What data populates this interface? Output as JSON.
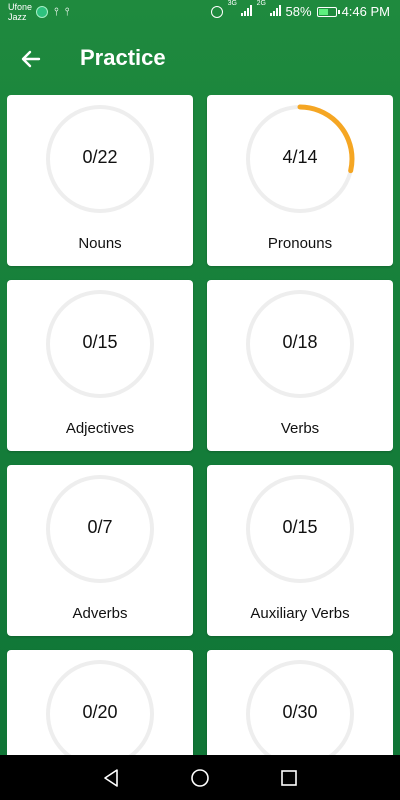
{
  "status_bar": {
    "carrier_line1": "Ufone",
    "carrier_line2": "Jazz",
    "net_type_1": "3G",
    "net_type_2": "2G",
    "battery_percent": "58%",
    "battery_level": 0.58,
    "time": "4:46 PM"
  },
  "app_bar": {
    "title": "Practice",
    "back_icon": "arrow-left-icon"
  },
  "colors": {
    "background": "#1a8a3c",
    "progress_accent": "#f5a623",
    "ring_track": "#eeeeee"
  },
  "cards": [
    {
      "label": "Nouns",
      "count": "0/22",
      "done": 0,
      "total": 22
    },
    {
      "label": "Pronouns",
      "count": "4/14",
      "done": 4,
      "total": 14
    },
    {
      "label": "Adjectives",
      "count": "0/15",
      "done": 0,
      "total": 15
    },
    {
      "label": "Verbs",
      "count": "0/18",
      "done": 0,
      "total": 18
    },
    {
      "label": "Adverbs",
      "count": "0/7",
      "done": 0,
      "total": 7
    },
    {
      "label": "Auxiliary Verbs",
      "count": "0/15",
      "done": 0,
      "total": 15
    },
    {
      "label": "",
      "count": "0/20",
      "done": 0,
      "total": 20
    },
    {
      "label": "",
      "count": "0/30",
      "done": 0,
      "total": 30
    }
  ],
  "nav_bar": {
    "back": "triangle-back-icon",
    "home": "circle-home-icon",
    "recents": "square-recents-icon"
  }
}
